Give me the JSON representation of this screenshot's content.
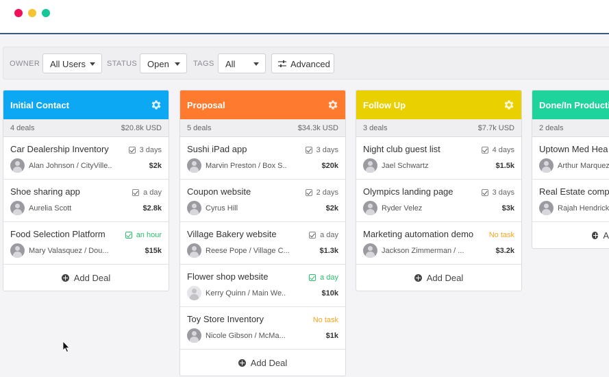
{
  "window": {
    "controls": [
      {
        "name": "close",
        "color": "#f0115a"
      },
      {
        "name": "minimize",
        "color": "#f6c431"
      },
      {
        "name": "maximize",
        "color": "#18c799"
      }
    ]
  },
  "filters": {
    "owner_label": "OWNER",
    "owner_value": "All Users",
    "status_label": "STATUS",
    "status_value": "Open",
    "tags_label": "TAGS",
    "tags_value": "All",
    "advanced_label": "Advanced"
  },
  "add_deal_label": "Add Deal",
  "columns": [
    {
      "name": "Initial Contact",
      "color": "#0da8f3",
      "deal_count": "4 deals",
      "total": "$20.8k USD",
      "cards": [
        {
          "title": "Car Dealership Inventory",
          "task": "3 days",
          "person": "Alan Johnson / CityVille..",
          "value": "$2k"
        },
        {
          "title": "Shoe sharing app",
          "task": "a day",
          "person": "Aurelia Scott",
          "value": "$2.8k"
        },
        {
          "title": "Food Selection Platform",
          "task": "an hour",
          "person": "Mary Valasquez / Dou...",
          "value": "$15k"
        }
      ]
    },
    {
      "name": "Proposal",
      "color": "#fe7a2e",
      "deal_count": "5 deals",
      "total": "$34.3k USD",
      "cards": [
        {
          "title": "Sushi iPad app",
          "task": "3 days",
          "person": "Marvin Preston / Box S..",
          "value": "$20k"
        },
        {
          "title": "Coupon website",
          "task": "2 days",
          "person": "Cyrus Hill",
          "value": "$2k"
        },
        {
          "title": "Village Bakery website",
          "task": "a day",
          "person": "Reese Pope / Village C...",
          "value": "$1.3k"
        },
        {
          "title": "Flower shop website",
          "task": "a day",
          "person": "Kerry Quinn / Main We..",
          "value": "$10k"
        },
        {
          "title": "Toy Store Inventory",
          "task": "No task",
          "person": "Nicole Gibson / McMa...",
          "value": "$1k"
        }
      ]
    },
    {
      "name": "Follow Up",
      "color": "#e9d000",
      "deal_count": "3 deals",
      "total": "$7.7k USD",
      "cards": [
        {
          "title": "Night club guest list",
          "task": "4 days",
          "person": "Jael Schwartz",
          "value": "$1.5k"
        },
        {
          "title": "Olympics landing page",
          "task": "3 days",
          "person": "Ryder Velez",
          "value": "$3k"
        },
        {
          "title": "Marketing automation demo",
          "task": "No task",
          "person": "Jackson Zimmerman / ...",
          "value": "$3.2k"
        }
      ]
    },
    {
      "name": "Done/In Productio",
      "color": "#1fd49c",
      "deal_count": "2 deals",
      "cards": [
        {
          "title": "Uptown Med Hea",
          "person": "Arthur Marquez"
        },
        {
          "title": "Real Estate comp",
          "person": "Rajah Hendrick"
        }
      ],
      "add_partial": "A"
    }
  ]
}
